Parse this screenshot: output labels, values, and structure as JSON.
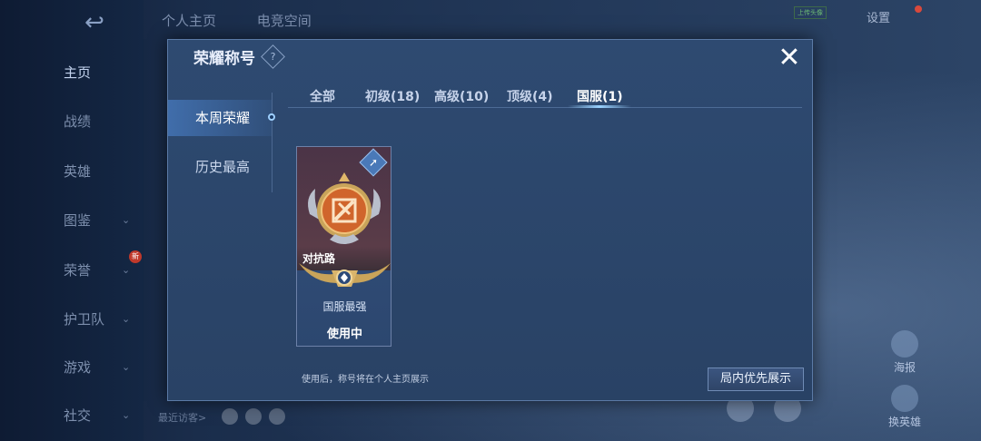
{
  "background": {
    "back_icon": "back-arrow-icon",
    "top_tabs": [
      "个人主页",
      "电竞空间"
    ],
    "settings_label": "设置",
    "nav": [
      {
        "label": "主页",
        "active": true,
        "chevron": false
      },
      {
        "label": "战绩",
        "active": false,
        "chevron": false
      },
      {
        "label": "英雄",
        "active": false,
        "chevron": false
      },
      {
        "label": "图鉴",
        "active": false,
        "chevron": true
      },
      {
        "label": "荣誉",
        "active": false,
        "chevron": true
      },
      {
        "label": "护卫队",
        "active": false,
        "chevron": true
      },
      {
        "label": "游戏",
        "active": false,
        "chevron": true
      },
      {
        "label": "社交",
        "active": false,
        "chevron": true
      }
    ],
    "right_icons": [
      {
        "label": "海报"
      },
      {
        "label": "换英雄"
      }
    ],
    "visitors_label": "最近访客>"
  },
  "dialog": {
    "title": "荣耀称号",
    "help_icon": "?",
    "close_icon": "✕",
    "side_tabs": [
      {
        "label": "本周荣耀",
        "active": true
      },
      {
        "label": "历史最高",
        "active": false
      }
    ],
    "filter_tabs": [
      {
        "label": "全部",
        "active": false
      },
      {
        "label": "初级(18)",
        "active": false
      },
      {
        "label": "高级(10)",
        "active": false
      },
      {
        "label": "顶级(4)",
        "active": false
      },
      {
        "label": "国服(1)",
        "active": true
      }
    ],
    "card": {
      "tag": "对抗路",
      "title": "国服最强",
      "status": "使用中",
      "share_icon": "share-icon"
    },
    "hint": "使用后，称号将在个人主页展示",
    "priority_button": "局内优先展示"
  },
  "colors": {
    "accent": "#9ad2ff",
    "dialog_bg": "#2e4a71",
    "emblem_orange": "#d0652c",
    "gold": "#c9a45a"
  }
}
